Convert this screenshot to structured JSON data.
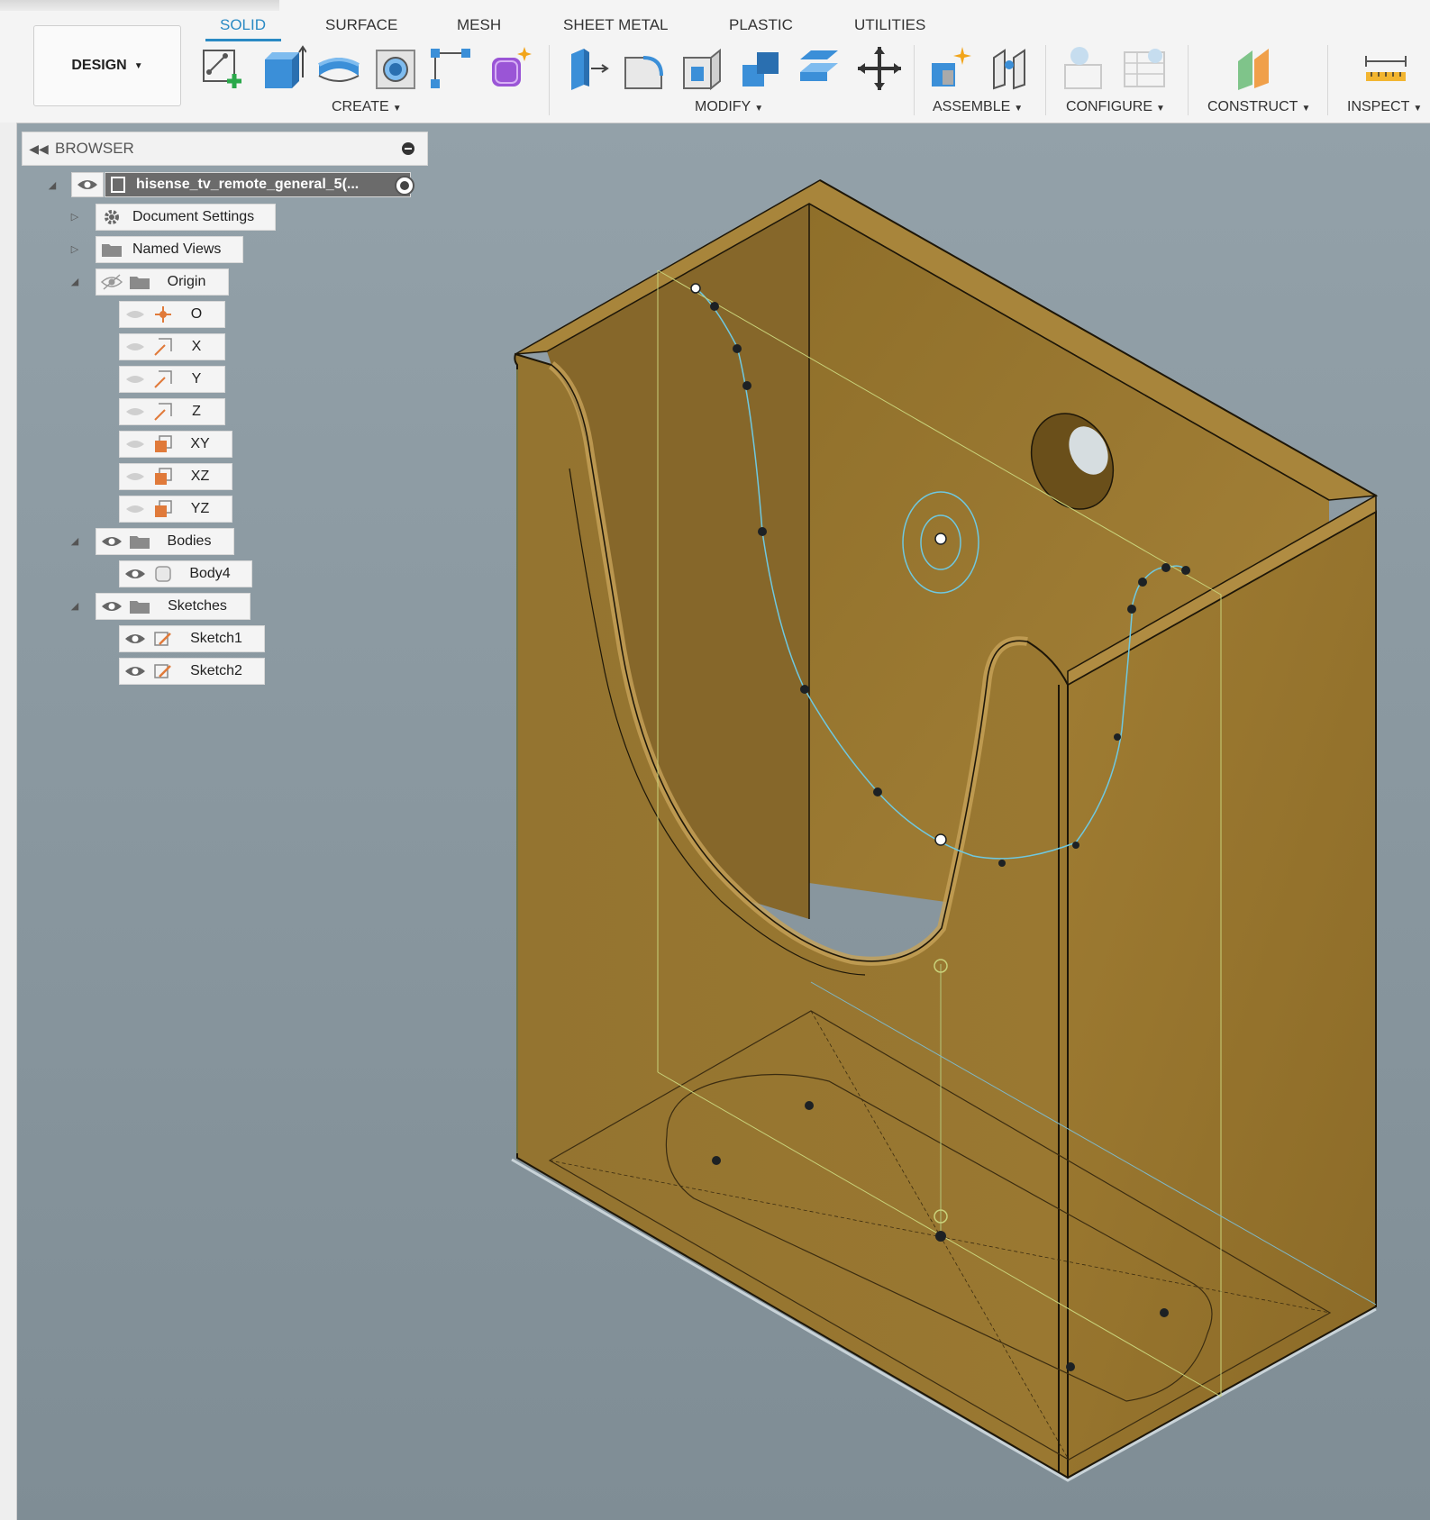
{
  "toolbar": {
    "design_label": "DESIGN",
    "tabs": [
      "SOLID",
      "SURFACE",
      "MESH",
      "SHEET METAL",
      "PLASTIC",
      "UTILITIES"
    ],
    "active_tab": "SOLID",
    "groups": {
      "create": "CREATE",
      "modify": "MODIFY",
      "assemble": "ASSEMBLE",
      "configure": "CONFIGURE",
      "construct": "CONSTRUCT",
      "inspect": "INSPECT"
    }
  },
  "browser": {
    "title": "BROWSER",
    "root": "hisense_tv_remote_general_5(...",
    "items": {
      "document_settings": "Document Settings",
      "named_views": "Named Views",
      "origin": "Origin",
      "o": "O",
      "x": "X",
      "y": "Y",
      "z": "Z",
      "xy": "XY",
      "xz": "XZ",
      "yz": "YZ",
      "bodies": "Bodies",
      "body4": "Body4",
      "sketches": "Sketches",
      "sketch1": "Sketch1",
      "sketch2": "Sketch2"
    }
  },
  "colors": {
    "viewport_bg": "#8d9ba3",
    "body_face_light": "#a07c34",
    "body_face_dark": "#8a6a28",
    "sketch_line": "#6fc8e0",
    "accent": "#2a8ac4"
  }
}
